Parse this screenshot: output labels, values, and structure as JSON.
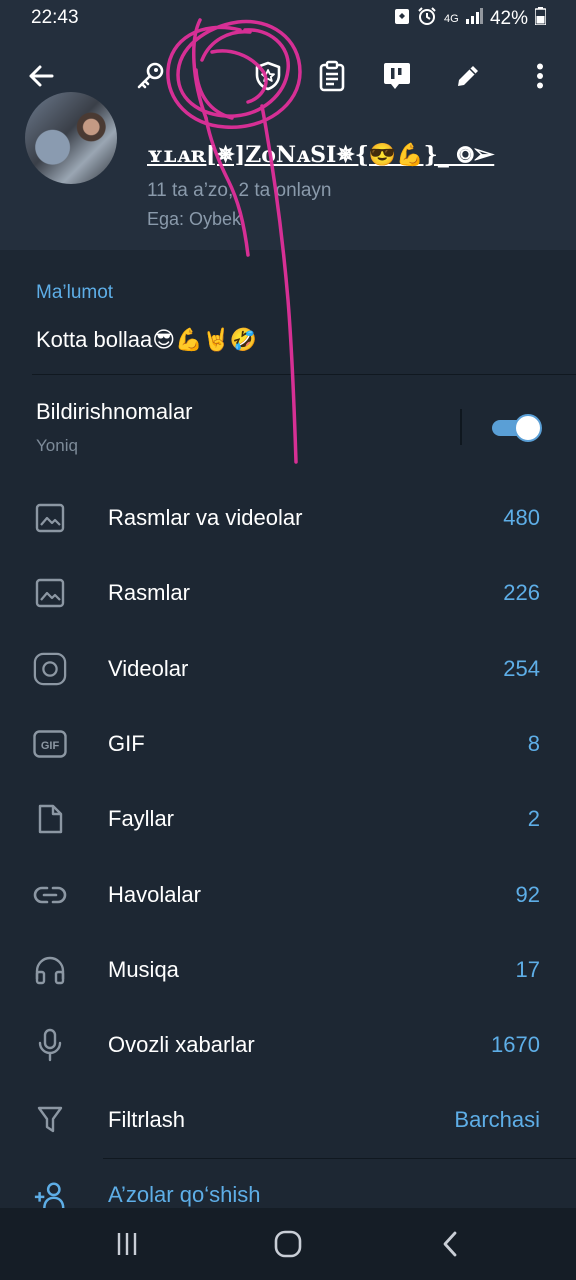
{
  "status_bar": {
    "time": "22:43",
    "network": "4G",
    "battery": "42%"
  },
  "toolbar": {
    "icons": [
      "back-arrow-icon",
      "key-icon",
      "shield-star-icon",
      "clipboard-icon",
      "poll-icon",
      "pencil-icon",
      "more-vertical-icon"
    ]
  },
  "group": {
    "name": "ʏʟᴀʀ[✵]ZᴏNᴀSI✵{😎💪}_ ⭗➢",
    "members": "11 ta a’zo, 2 ta onlayn",
    "owner": "Ega: Oybek"
  },
  "info": {
    "section_title": "Ma’lumot",
    "description": "Kotta bollaa😎💪🤘🤣"
  },
  "notifications": {
    "label": "Bildirishnomalar",
    "status": "Yoniq",
    "enabled": true
  },
  "media_rows": [
    {
      "label": "Rasmlar va videolar",
      "value": "480",
      "icon": "image-icon"
    },
    {
      "label": "Rasmlar",
      "value": "226",
      "icon": "image-icon"
    },
    {
      "label": "Videolar",
      "value": "254",
      "icon": "video-circle-icon"
    },
    {
      "label": "GIF",
      "value": "8",
      "icon": "gif-icon"
    },
    {
      "label": "Fayllar",
      "value": "2",
      "icon": "file-icon"
    },
    {
      "label": "Havolalar",
      "value": "92",
      "icon": "link-icon"
    },
    {
      "label": "Musiqa",
      "value": "17",
      "icon": "headphones-icon"
    },
    {
      "label": "Ovozli xabarlar",
      "value": "1670",
      "icon": "microphone-icon"
    },
    {
      "label": "Filtrlash",
      "value": "Barchasi",
      "icon": "filter-icon"
    }
  ],
  "add_members": {
    "label": "A’zolar qo‘shish"
  },
  "colors": {
    "background": "#1d2733",
    "header": "#242f3d",
    "accent": "#5eaee7",
    "annotation": "#e0309a"
  }
}
